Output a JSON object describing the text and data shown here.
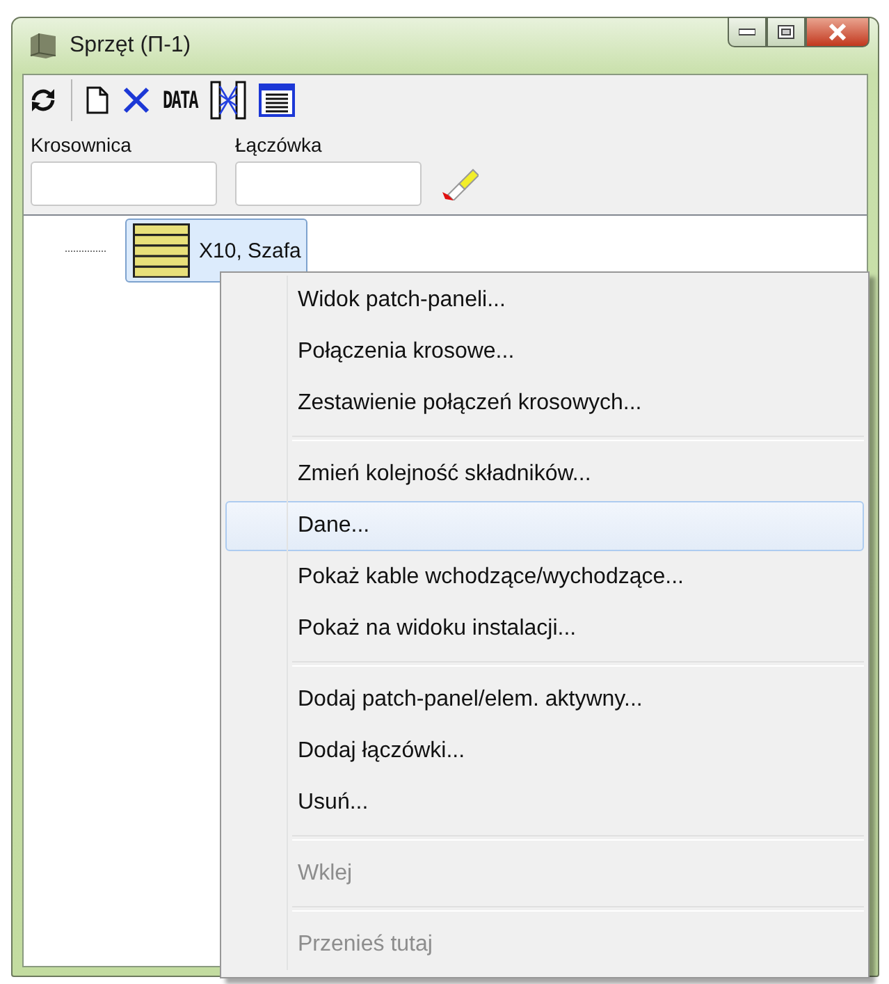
{
  "window": {
    "title": "Sprzęt (Π-1)"
  },
  "toolbar": [
    {
      "kind": "refresh"
    },
    {
      "kind": "new"
    },
    {
      "kind": "delete"
    },
    {
      "kind": "text",
      "label": "DATA"
    },
    {
      "kind": "crossconnect"
    },
    {
      "kind": "list"
    }
  ],
  "filters": [
    {
      "label": "Krosownica"
    },
    {
      "label": "Łączówka"
    }
  ],
  "tree": {
    "items": [
      {
        "label": "X10, Szafa",
        "selected": true
      }
    ]
  },
  "context_menu": [
    {
      "kind": "item",
      "label": "Widok patch-paneli...",
      "selected": false,
      "disabled": false
    },
    {
      "kind": "item",
      "label": "Połączenia krosowe...",
      "selected": false,
      "disabled": false
    },
    {
      "kind": "item",
      "label": "Zestawienie połączeń krosowych...",
      "selected": false,
      "disabled": false
    },
    {
      "kind": "separator"
    },
    {
      "kind": "item",
      "label": "Zmień kolejność składników...",
      "selected": false,
      "disabled": false
    },
    {
      "kind": "item",
      "label": "Dane...",
      "selected": true,
      "disabled": false
    },
    {
      "kind": "item",
      "label": "Pokaż kable wchodzące/wychodzące...",
      "selected": false,
      "disabled": false
    },
    {
      "kind": "item",
      "label": "Pokaż na widoku instalacji...",
      "selected": false,
      "disabled": false
    },
    {
      "kind": "separator"
    },
    {
      "kind": "item",
      "label": "Dodaj patch-panel/elem. aktywny...",
      "selected": false,
      "disabled": false
    },
    {
      "kind": "item",
      "label": "Dodaj łączówki...",
      "selected": false,
      "disabled": false
    },
    {
      "kind": "item",
      "label": "Usuń...",
      "selected": false,
      "disabled": false
    },
    {
      "kind": "separator"
    },
    {
      "kind": "item",
      "label": "Wklej",
      "selected": false,
      "disabled": true
    },
    {
      "kind": "separator"
    },
    {
      "kind": "item",
      "label": "Przenieś tutaj",
      "selected": false,
      "disabled": true
    }
  ]
}
